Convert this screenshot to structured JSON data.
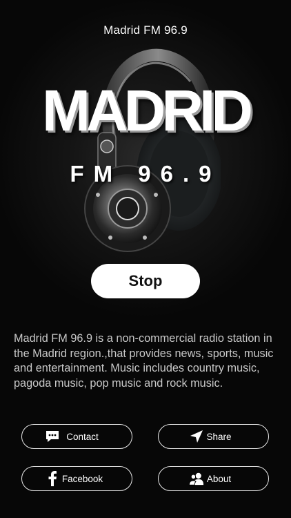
{
  "app": {
    "title": "Madrid FM 96.9"
  },
  "logo": {
    "word": "MADRID",
    "sub": "FM 96.9"
  },
  "player": {
    "stop_label": "Stop"
  },
  "description": "Madrid FM 96.9 is a non-commercial radio station in the Madrid region.,that provides news, sports, music and entertainment. Music includes country music, pagoda music, pop music and rock music.",
  "actions": {
    "contact": {
      "label": "Contact",
      "icon": "chat-bubble-icon"
    },
    "share": {
      "label": "Share",
      "icon": "paper-plane-icon"
    },
    "facebook": {
      "label": "Facebook",
      "icon": "facebook-icon"
    },
    "about": {
      "label": "About",
      "icon": "people-icon"
    }
  },
  "colors": {
    "background": "#070707",
    "text": "#ffffff",
    "description_text": "#c9c9c9",
    "button_bg": "#ffffff"
  }
}
